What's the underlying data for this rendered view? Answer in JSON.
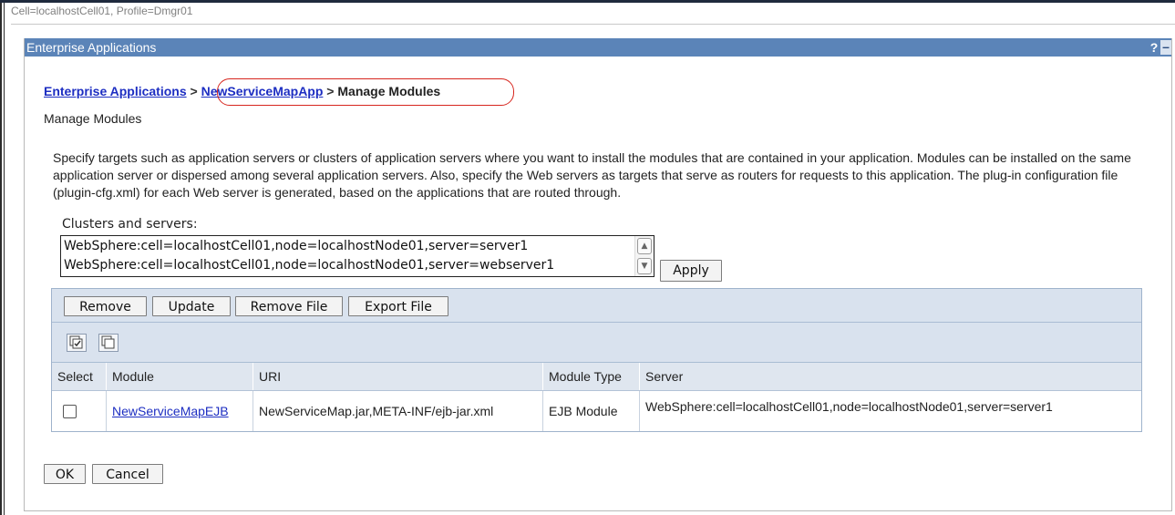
{
  "cell_bar": {
    "text": "Cell=localhostCell01, Profile=Dmgr01"
  },
  "portlet": {
    "title": "Enterprise Applications",
    "help": "?",
    "minimize": "–"
  },
  "breadcrumb": {
    "item1": "Enterprise Applications",
    "sep1": " > ",
    "item2": "NewServiceMapApp",
    "sep2": " > ",
    "current": "Manage Modules"
  },
  "page_subtitle": "Manage Modules",
  "description": "Specify targets such as application servers or clusters of application servers where you want to install the modules that are contained in your application. Modules can be installed on the same application server or dispersed among several application servers. Also, specify the Web servers as targets that serve as routers for requests to this application. The plug-in configuration file (plugin-cfg.xml) for each Web server is generated, based on the applications that are routed through.",
  "clusters": {
    "label": "Clusters and servers:",
    "options": [
      "WebSphere:cell=localhostCell01,node=localhostNode01,server=server1",
      "WebSphere:cell=localhostCell01,node=localhostNode01,server=webserver1"
    ],
    "apply_label": "Apply"
  },
  "toolbar": {
    "remove_label": "Remove",
    "update_label": "Update",
    "remove_file_label": "Remove File",
    "export_file_label": "Export File"
  },
  "table": {
    "headers": [
      "Select",
      "Module",
      "URI",
      "Module Type",
      "Server"
    ],
    "rows": [
      {
        "module": "NewServiceMapEJB",
        "uri": "NewServiceMap.jar,META-INF/ejb-jar.xml",
        "type": "EJB Module",
        "server": "WebSphere:cell=localhostCell01,node=localhostNode01,server=server1"
      }
    ]
  },
  "footer": {
    "ok_label": "OK",
    "cancel_label": "Cancel"
  },
  "colors": {
    "title_bar": "#5b84b8",
    "link": "#1d2ec2",
    "table_band": "#d9e2ee",
    "highlight": "#d7261e"
  }
}
